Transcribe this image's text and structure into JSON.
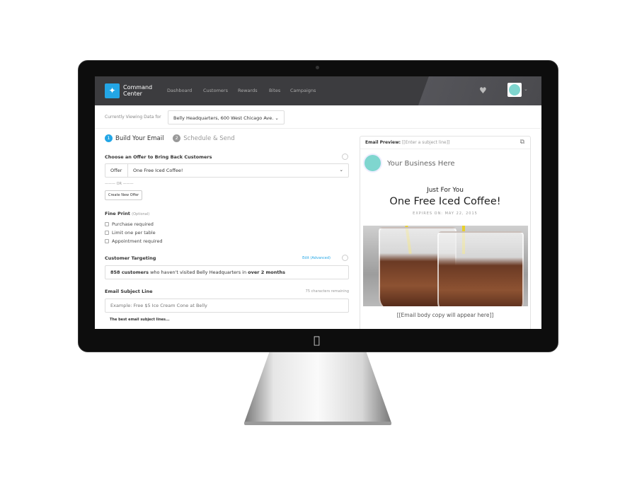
{
  "nav": {
    "brand_line1": "Command",
    "brand_line2": "Center",
    "items": [
      "Dashboard",
      "Customers",
      "Rewards",
      "Bites",
      "Campaigns"
    ]
  },
  "viewing": {
    "label": "Currently Viewing Data for",
    "location": "Belly Headquarters, 600 West Chicago Ave."
  },
  "steps": [
    {
      "num": "1",
      "label": "Build Your Email"
    },
    {
      "num": "2",
      "label": "Schedule & Send"
    }
  ],
  "offer": {
    "heading": "Choose an Offer to Bring Back Customers",
    "prefix": "Offer",
    "value": "One Free Iced Coffee!",
    "or": "OR",
    "create_button": "Create New Offer"
  },
  "fine_print": {
    "heading": "Fine Print",
    "optional": "(Optional)",
    "options": [
      "Purchase required",
      "Limit one per table",
      "Appointment required"
    ]
  },
  "targeting": {
    "heading": "Customer Targeting",
    "edit_link": "Edit (Advanced)",
    "count": "858 customers",
    "middle": " who haven't visited Belly Headquarters in ",
    "duration": "over 2 months"
  },
  "subject": {
    "heading": "Email Subject Line",
    "remaining": "75 characters remaining",
    "placeholder": "Example: Free $5 Ice Cream Cone at Belly",
    "tips": "The best email subject lines..."
  },
  "preview": {
    "label": "Email Preview:",
    "subject": "[[Enter a subject line]]",
    "business": "Your Business Here",
    "tagline": "Just For You",
    "offer": "One Free Iced Coffee!",
    "expires": "EXPIRES ON: MAY 22, 2015",
    "body": "[[Email body copy will appear here]]"
  },
  "colors": {
    "accent": "#23a6e6",
    "nav_bg": "#3c3c3f"
  }
}
